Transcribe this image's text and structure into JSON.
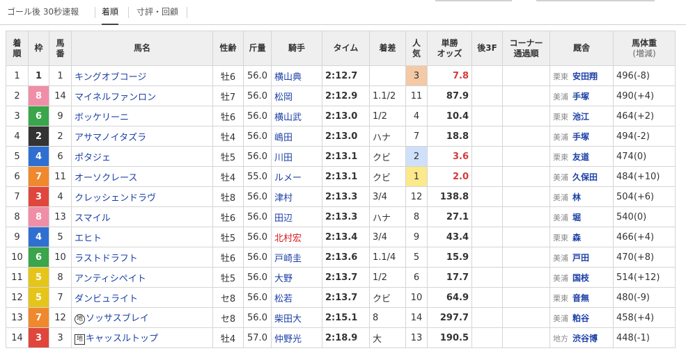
{
  "tabs": [
    {
      "label": "ゴール後 30秒速報"
    },
    {
      "label": "着順"
    },
    {
      "label": "寸評・回顧"
    }
  ],
  "table": {
    "headers": {
      "rank": [
        "着",
        "順"
      ],
      "waku": "枠",
      "umaban": [
        "馬",
        "番"
      ],
      "horse": "馬名",
      "sexage": "性齢",
      "weight": "斤量",
      "jockey": "騎手",
      "time": "タイム",
      "margin": "着差",
      "popularity": [
        "人",
        "気"
      ],
      "odds": [
        "単勝",
        "オッズ"
      ],
      "last3f": "後3F",
      "corner": [
        "コーナー",
        "通過順"
      ],
      "trainer": "厩舎",
      "bodyweight": [
        "馬体重",
        "(増減)"
      ]
    },
    "colors": {
      "1": "#ffffff",
      "2": "#333333",
      "3": "#e0463c",
      "4": "#2f6fd1",
      "5": "#e6c51a",
      "6": "#3aa54a",
      "7": "#f0882d",
      "8": "#f08ea8"
    },
    "rows": [
      {
        "rank": "1",
        "waku": "1",
        "umaban": "1",
        "mark": "",
        "horse": "キングオブコージ",
        "sexage": "牡6",
        "weight": "56.0",
        "jockey": "横山典",
        "jockey_red": false,
        "time": "2:12.7",
        "margin": "",
        "popularity": "3",
        "odds": "7.8",
        "odds_red": true,
        "region": "栗東",
        "trainer": "安田翔",
        "bodyweight": "496(-8)"
      },
      {
        "rank": "2",
        "waku": "8",
        "umaban": "14",
        "mark": "",
        "horse": "マイネルファンロン",
        "sexage": "牡7",
        "weight": "56.0",
        "jockey": "松岡",
        "jockey_red": false,
        "time": "2:12.9",
        "margin": "1.1/2",
        "popularity": "11",
        "odds": "87.9",
        "odds_red": false,
        "region": "美浦",
        "trainer": "手塚",
        "bodyweight": "490(+4)"
      },
      {
        "rank": "3",
        "waku": "6",
        "umaban": "9",
        "mark": "",
        "horse": "ボッケリーニ",
        "sexage": "牡6",
        "weight": "56.0",
        "jockey": "横山武",
        "jockey_red": false,
        "time": "2:13.0",
        "margin": "1/2",
        "popularity": "4",
        "odds": "10.4",
        "odds_red": false,
        "region": "栗東",
        "trainer": "池江",
        "bodyweight": "464(+2)"
      },
      {
        "rank": "4",
        "waku": "2",
        "umaban": "2",
        "mark": "",
        "horse": "アサマノイタズラ",
        "sexage": "牡4",
        "weight": "56.0",
        "jockey": "嶋田",
        "jockey_red": false,
        "time": "2:13.0",
        "margin": "ハナ",
        "popularity": "7",
        "odds": "18.8",
        "odds_red": false,
        "region": "美浦",
        "trainer": "手塚",
        "bodyweight": "494(-2)"
      },
      {
        "rank": "5",
        "waku": "4",
        "umaban": "6",
        "mark": "",
        "horse": "ポタジェ",
        "sexage": "牡5",
        "weight": "56.0",
        "jockey": "川田",
        "jockey_red": false,
        "time": "2:13.1",
        "margin": "クビ",
        "popularity": "2",
        "odds": "3.6",
        "odds_red": true,
        "region": "栗東",
        "trainer": "友道",
        "bodyweight": "474(0)"
      },
      {
        "rank": "6",
        "waku": "7",
        "umaban": "11",
        "mark": "",
        "horse": "オーソクレース",
        "sexage": "牡4",
        "weight": "55.0",
        "jockey": "ルメー",
        "jockey_red": false,
        "time": "2:13.1",
        "margin": "クビ",
        "popularity": "1",
        "odds": "2.0",
        "odds_red": true,
        "region": "美浦",
        "trainer": "久保田",
        "bodyweight": "484(+10)"
      },
      {
        "rank": "7",
        "waku": "3",
        "umaban": "4",
        "mark": "",
        "horse": "クレッシェンドラヴ",
        "sexage": "牡8",
        "weight": "56.0",
        "jockey": "津村",
        "jockey_red": false,
        "time": "2:13.3",
        "margin": "3/4",
        "popularity": "12",
        "odds": "138.8",
        "odds_red": false,
        "region": "美浦",
        "trainer": "林",
        "bodyweight": "504(+6)"
      },
      {
        "rank": "8",
        "waku": "8",
        "umaban": "13",
        "mark": "",
        "horse": "スマイル",
        "sexage": "牡6",
        "weight": "56.0",
        "jockey": "田辺",
        "jockey_red": false,
        "time": "2:13.3",
        "margin": "ハナ",
        "popularity": "8",
        "odds": "27.1",
        "odds_red": false,
        "region": "美浦",
        "trainer": "堀",
        "bodyweight": "540(0)"
      },
      {
        "rank": "9",
        "waku": "4",
        "umaban": "5",
        "mark": "",
        "horse": "エヒト",
        "sexage": "牡5",
        "weight": "56.0",
        "jockey": "北村宏",
        "jockey_red": true,
        "time": "2:13.4",
        "margin": "3/4",
        "popularity": "9",
        "odds": "43.4",
        "odds_red": false,
        "region": "栗東",
        "trainer": "森",
        "bodyweight": "466(+4)"
      },
      {
        "rank": "10",
        "waku": "6",
        "umaban": "10",
        "mark": "",
        "horse": "ラストドラフト",
        "sexage": "牡6",
        "weight": "56.0",
        "jockey": "戸崎圭",
        "jockey_red": false,
        "time": "2:13.6",
        "margin": "1.1/4",
        "popularity": "5",
        "odds": "15.9",
        "odds_red": false,
        "region": "美浦",
        "trainer": "戸田",
        "bodyweight": "470(+8)"
      },
      {
        "rank": "11",
        "waku": "5",
        "umaban": "8",
        "mark": "",
        "horse": "アンティシペイト",
        "sexage": "牡5",
        "weight": "56.0",
        "jockey": "大野",
        "jockey_red": false,
        "time": "2:13.7",
        "margin": "1/2",
        "popularity": "6",
        "odds": "17.7",
        "odds_red": false,
        "region": "美浦",
        "trainer": "国枝",
        "bodyweight": "514(+12)"
      },
      {
        "rank": "12",
        "waku": "5",
        "umaban": "7",
        "mark": "",
        "horse": "ダンビュライト",
        "sexage": "セ8",
        "weight": "56.0",
        "jockey": "松若",
        "jockey_red": false,
        "time": "2:13.7",
        "margin": "クビ",
        "popularity": "10",
        "odds": "64.9",
        "odds_red": false,
        "region": "栗東",
        "trainer": "音無",
        "bodyweight": "480(-9)"
      },
      {
        "rank": "13",
        "waku": "7",
        "umaban": "12",
        "mark": "地",
        "mark_shape": "circle",
        "horse": "ソッサスブレイ",
        "sexage": "セ8",
        "weight": "56.0",
        "jockey": "柴田大",
        "jockey_red": false,
        "time": "2:15.1",
        "margin": "8",
        "popularity": "14",
        "odds": "297.7",
        "odds_red": false,
        "region": "美浦",
        "trainer": "粕谷",
        "bodyweight": "458(+4)"
      },
      {
        "rank": "14",
        "waku": "3",
        "umaban": "3",
        "mark": "地",
        "mark_shape": "square",
        "horse": "キャッスルトップ",
        "sexage": "牡4",
        "weight": "57.0",
        "jockey": "仲野光",
        "jockey_red": false,
        "time": "2:18.9",
        "margin": "大",
        "popularity": "13",
        "odds": "190.5",
        "odds_red": false,
        "region": "地方",
        "trainer": "渋谷博",
        "bodyweight": "448(-1)"
      }
    ]
  }
}
